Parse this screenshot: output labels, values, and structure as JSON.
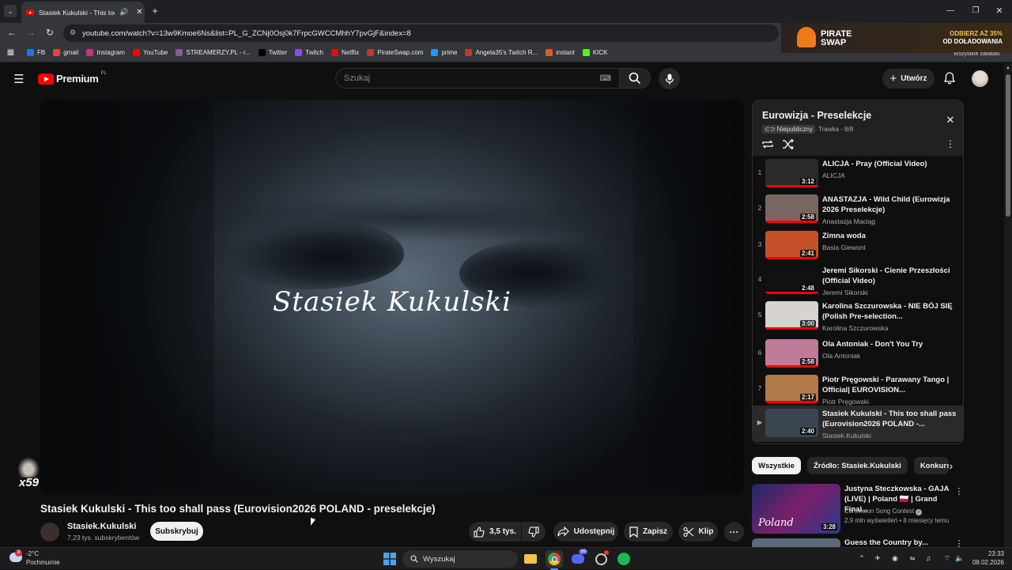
{
  "browser": {
    "tab_title": "Stasiek Kukulski - This too sh",
    "url": "youtube.com/watch?v=13w9Kmoe6Ns&list=PL_G_ZCNj0Osj0k7FrpcGWCCMhhY7pvGjF&index=8",
    "bookmarks": [
      {
        "label": "FB",
        "color": "#1877f2"
      },
      {
        "label": "gmail",
        "color": "#ea4335"
      },
      {
        "label": "Instagram",
        "color": "#c13584"
      },
      {
        "label": "YouTube",
        "color": "#ff0000"
      },
      {
        "label": "STREAMERZY.PL - r...",
        "color": "#8a5a9a"
      },
      {
        "label": "Twitter",
        "color": "#000000"
      },
      {
        "label": "Twitch",
        "color": "#9146ff"
      },
      {
        "label": "Netflix",
        "color": "#e50914"
      },
      {
        "label": "PirateSwap.com",
        "color": "#c0392b"
      },
      {
        "label": "prime",
        "color": "#1a98ff"
      },
      {
        "label": "Angela35's Twitch R...",
        "color": "#c0392b"
      },
      {
        "label": "instant",
        "color": "#e05a2a"
      },
      {
        "label": "KICK",
        "color": "#53fc18"
      }
    ],
    "ad": {
      "brand_line1": "PIRATE",
      "brand_line2": "SWAP",
      "promo_line1": "ODBIERZ AŻ 35%",
      "promo_line2": "OD DOŁADOWANIA",
      "cut_text": "Wszystkie zakładki"
    }
  },
  "youtube": {
    "logo_text": "Premium",
    "logo_region": "PL",
    "search_placeholder": "Szukaj",
    "create_label": "Utwórz"
  },
  "video": {
    "overlay_text": "Stasiek Kukulski",
    "corner_badge": "x59",
    "title": "Stasiek Kukulski - This too shall pass (Eurovision2026 POLAND - preselekcje)",
    "channel": "Stasiek.Kukulski",
    "subscribers": "7,23 tys. subskrybentów",
    "subscribe_label": "Subskrybuj",
    "likes": "3,5 tys.",
    "share_label": "Udostępnij",
    "save_label": "Zapisz",
    "clip_label": "Klip"
  },
  "playlist": {
    "title": "Eurowizja - Preselekcje",
    "visibility": "Niepubliczny",
    "meta": "Trawka - 8/8",
    "items": [
      {
        "index": "1",
        "title": "ALICJA - Pray (Official Video)",
        "channel": "ALICJA",
        "duration": "3:12",
        "thumb": "#2a2a2a",
        "progress": 1.0
      },
      {
        "index": "2",
        "title": "ANASTAZJA - Wild Child (Eurowizja 2026 Preselekcje)",
        "channel": "Anastazja Maciąg",
        "duration": "2:58",
        "thumb": "#7a6660",
        "progress": 1.0
      },
      {
        "index": "3",
        "title": "Zimna woda",
        "channel": "Basia Giewont",
        "duration": "2:41",
        "thumb": "#c4502a",
        "progress": 1.0
      },
      {
        "index": "4",
        "title": "Jeremi Sikorski - Cienie Przeszłości (Official Video)",
        "channel": "Jeremi Sikorski",
        "duration": "2:48",
        "thumb": "#111111",
        "progress": 1.0
      },
      {
        "index": "5",
        "title": "Karolina Szczurowska - NIE BÓJ SIĘ (Polish Pre-selection...",
        "channel": "Karolina Szczurowska",
        "duration": "3:00",
        "thumb": "#d8d2d0",
        "progress": 1.0
      },
      {
        "index": "6",
        "title": "Ola Antoniak - Don't You Try",
        "channel": "Ola Antoniak",
        "duration": "2:58",
        "thumb": "#c07a9a",
        "progress": 1.0
      },
      {
        "index": "7",
        "title": "Piotr Pręgowski - Parawany Tango | Official| EUROVISION...",
        "channel": "Piotr Pręgowski",
        "duration": "2:17",
        "thumb": "#b07a4a",
        "progress": 1.0
      },
      {
        "index": "▶",
        "title": "Stasiek Kukulski - This too shall pass (Eurovision2026 POLAND -...",
        "channel": "Stasiek.Kukulski",
        "duration": "2:40",
        "thumb": "#3a4550",
        "progress": 0
      }
    ]
  },
  "chips": [
    "Wszystkie",
    "Źródło: Stasiek.Kukulski",
    "Konkurs"
  ],
  "recommendations": [
    {
      "title": "Justyna Steczkowska - GAJA (LIVE) | Poland 🇵🇱 | Grand Final...",
      "channel": "Eurovision Song Contest",
      "stats": "2,9 mln wyświetleń • 8 miesięcy temu",
      "duration": "3:28",
      "thumb_text": "Poland"
    },
    {
      "title": "Guess the Country by..."
    }
  ],
  "taskbar": {
    "temp": "-2°C",
    "weather": "Pochmurnie",
    "search_label": "Wyszukaj",
    "time": "23:33",
    "date": "08.02.2026",
    "discord_badge": "99"
  }
}
